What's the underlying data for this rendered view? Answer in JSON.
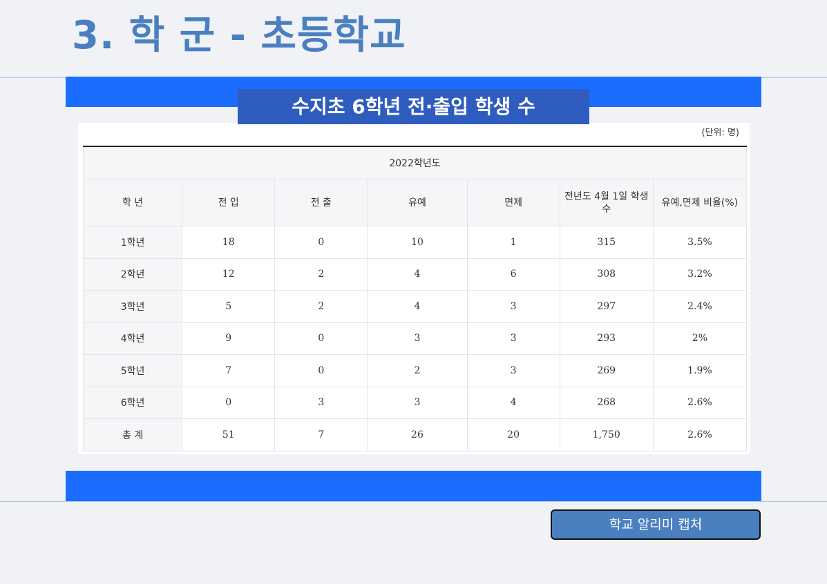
{
  "page": {
    "title": "3. 학 군 - 초등학교"
  },
  "table_section": {
    "title": "수지초 6학년 전·출입 학생 수",
    "unit": "(단위: 명)",
    "year_header": "2022학년도",
    "columns": [
      "학 년",
      "전 입",
      "전 출",
      "유예",
      "면제",
      "전년도 4월 1일 학생수",
      "유예,면제 비율(%)"
    ],
    "rows": [
      [
        "1학년",
        "18",
        "0",
        "10",
        "1",
        "315",
        "3.5%"
      ],
      [
        "2학년",
        "12",
        "2",
        "4",
        "6",
        "308",
        "3.2%"
      ],
      [
        "3학년",
        "5",
        "2",
        "4",
        "3",
        "297",
        "2.4%"
      ],
      [
        "4학년",
        "9",
        "0",
        "3",
        "3",
        "293",
        "2%"
      ],
      [
        "5학년",
        "7",
        "0",
        "2",
        "3",
        "269",
        "1.9%"
      ],
      [
        "6학년",
        "0",
        "3",
        "3",
        "4",
        "268",
        "2.6%"
      ],
      [
        "총 계",
        "51",
        "7",
        "26",
        "20",
        "1,750",
        "2.6%"
      ]
    ]
  },
  "footer": {
    "button_label": "학교 알리미 캡처"
  },
  "colors": {
    "title": "#4a7fc0",
    "band": "#1a6dff",
    "table_title_bg": "#2f5dbf",
    "button_bg": "#4a7fc0"
  }
}
